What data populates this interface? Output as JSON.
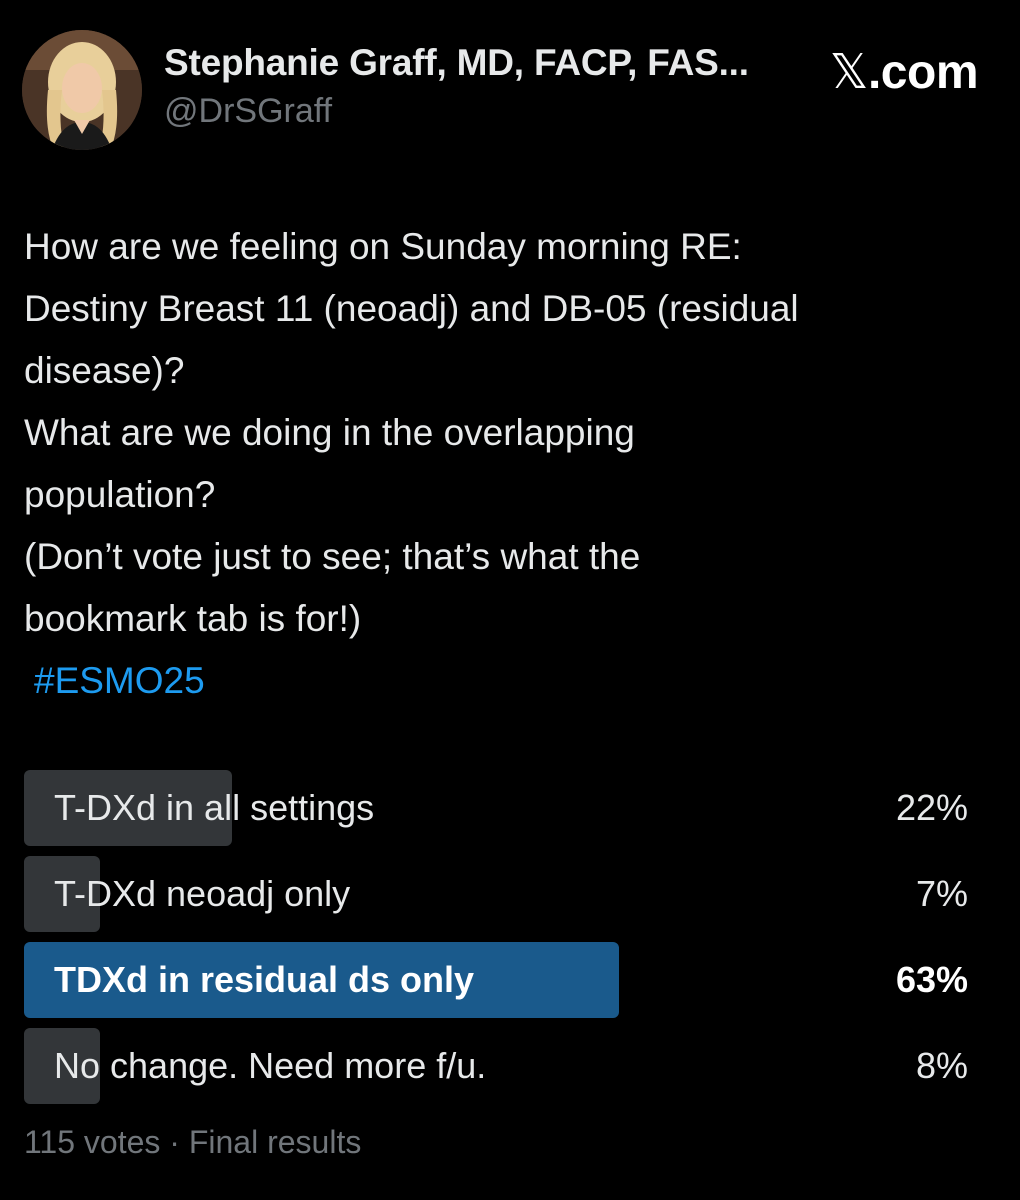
{
  "author": {
    "display_name": "Stephanie Graff, MD, FACP, FAS...",
    "handle": "@DrSGraff"
  },
  "brand": {
    "x_glyph": "𝕏",
    "suffix": ".com"
  },
  "tweet": {
    "lines": [
      "How are we feeling on Sunday morning RE:",
      "Destiny Breast 11 (neoadj) and DB-05 (residual",
      "disease)?",
      "What are we doing in the overlapping",
      "population?",
      "(Don’t vote just to see; that’s what the",
      "bookmark tab is for!)"
    ],
    "hashtag": "#ESMO25"
  },
  "poll": {
    "options": [
      {
        "label": "T-DXd in all settings",
        "percent": 22,
        "percent_text": "22%",
        "winner": false
      },
      {
        "label": "T-DXd neoadj only",
        "percent": 7,
        "percent_text": "7%",
        "winner": false
      },
      {
        "label": "TDXd in residual ds only",
        "percent": 63,
        "percent_text": "63%",
        "winner": true
      },
      {
        "label": "No change. Need more f/u.",
        "percent": 8,
        "percent_text": "8%",
        "winner": false
      }
    ],
    "votes": "115 votes",
    "separator": "·",
    "status": "Final results"
  },
  "colors": {
    "background": "#000000",
    "text": "#e7e9ea",
    "secondary_text": "#71767b",
    "hashtag": "#1d9bf0",
    "bar": "#333639",
    "winner_bar": "#1a5a8c"
  }
}
